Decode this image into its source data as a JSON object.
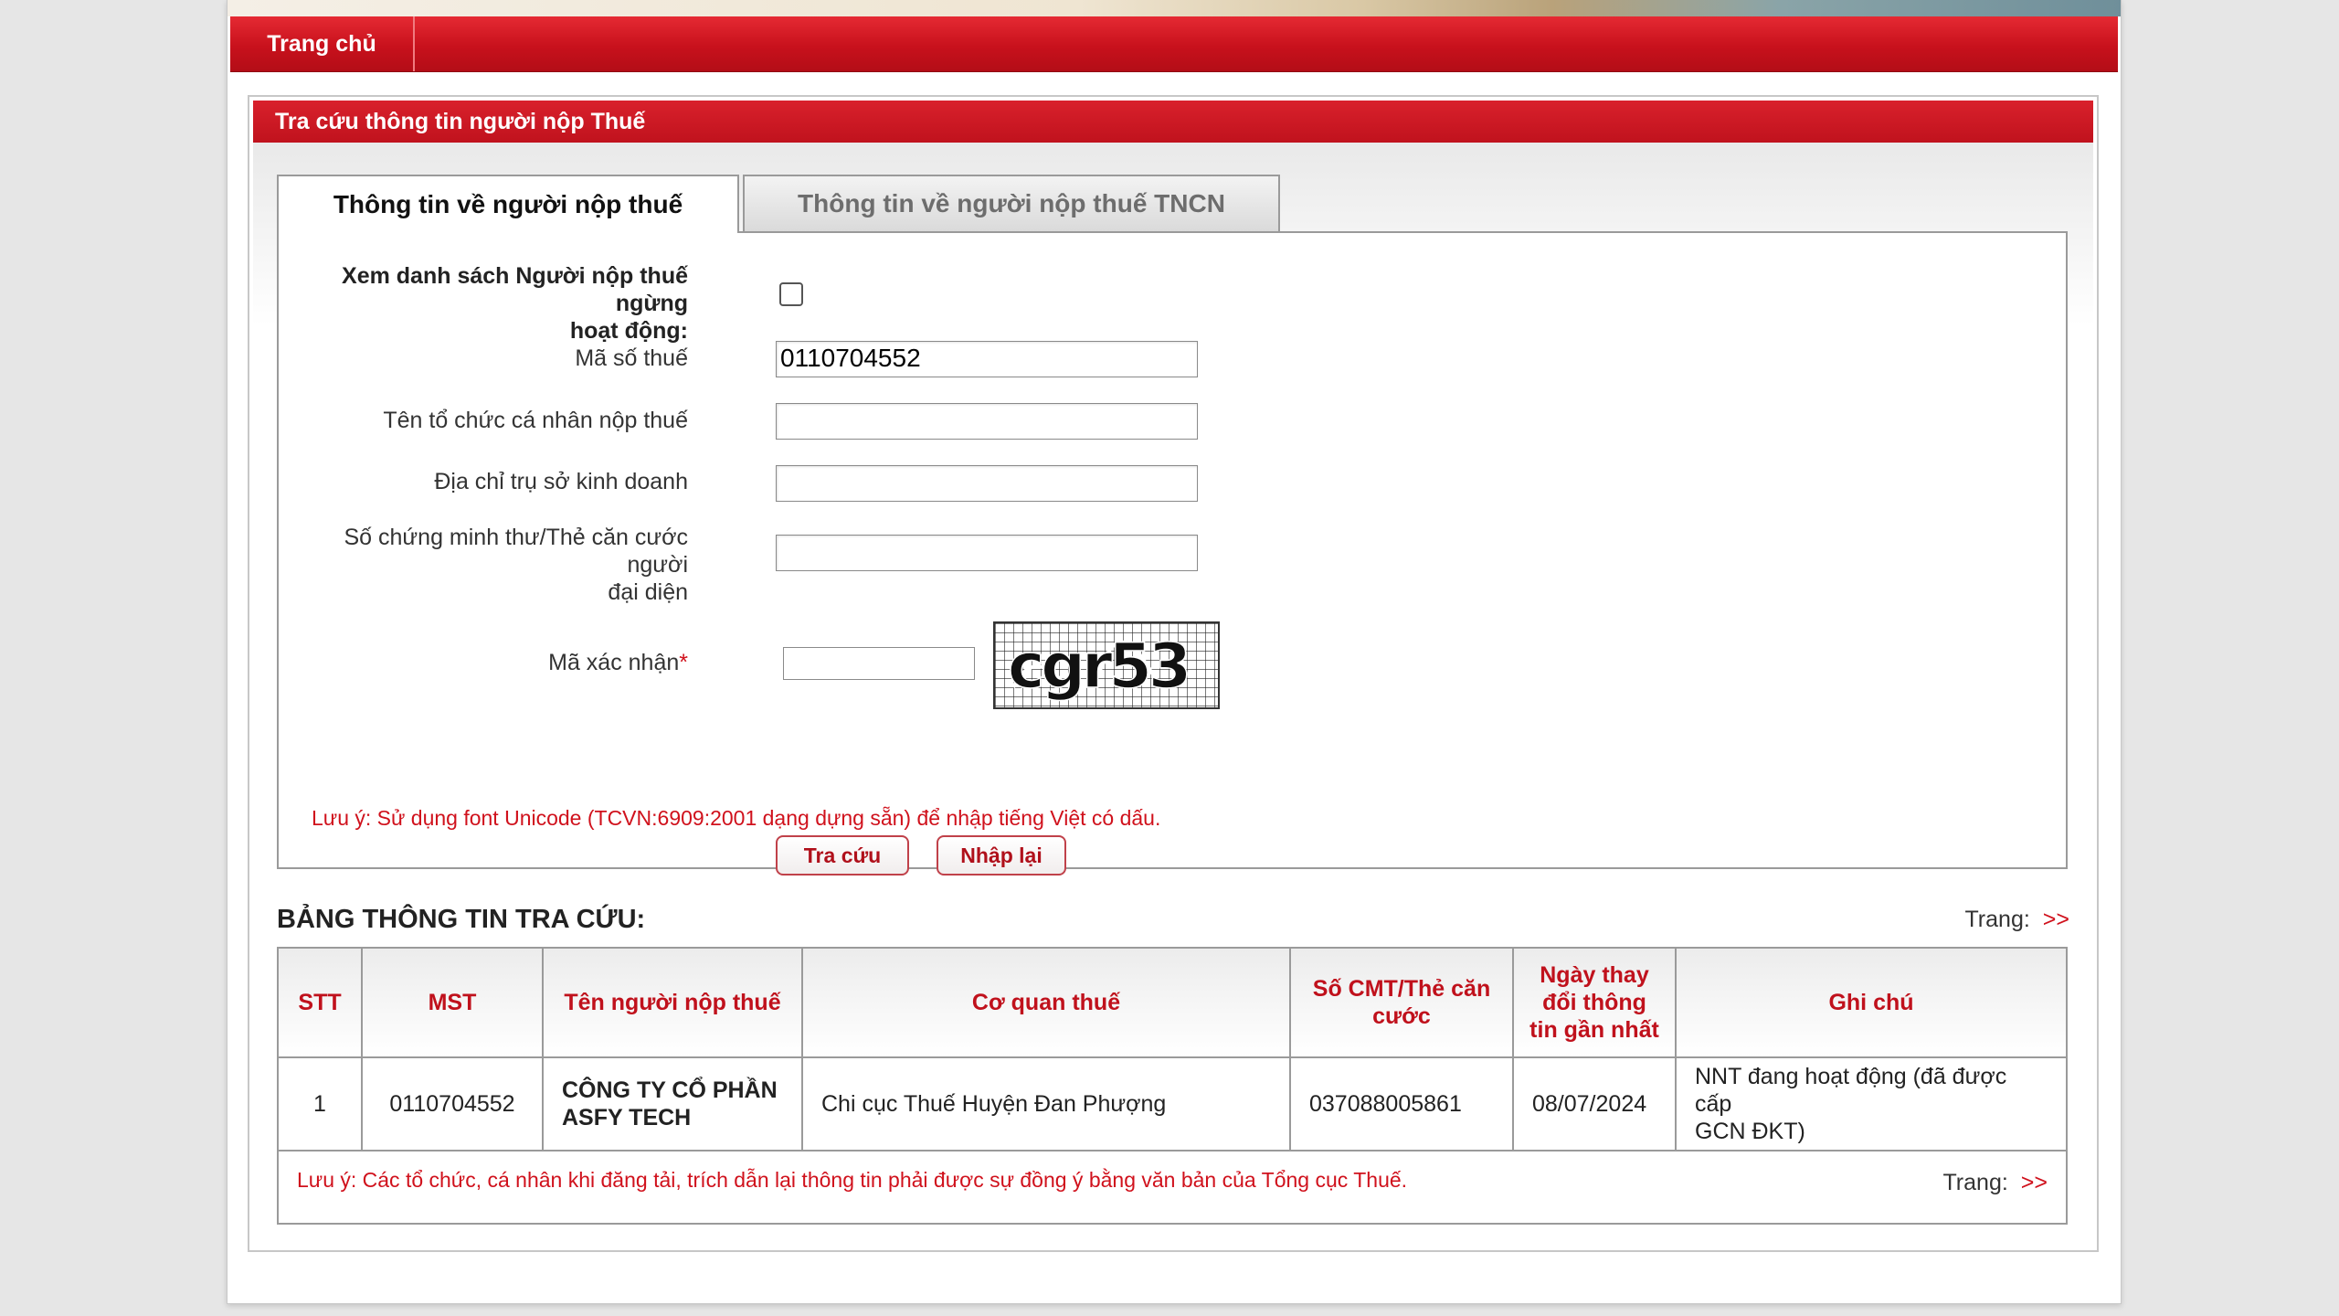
{
  "nav": {
    "home": "Trang chủ"
  },
  "panel": {
    "title": "Tra cứu thông tin người nộp Thuế"
  },
  "tabs": [
    {
      "label": "Thông tin về người nộp thuế",
      "active": true
    },
    {
      "label": "Thông tin về người nộp thuế TNCN",
      "active": false
    }
  ],
  "form": {
    "inactive_label_1": "Xem danh sách Người nộp thuế ngừng",
    "inactive_label_2": "hoạt động:",
    "tax_code_label": "Mã số thuế",
    "tax_code_value": "0110704552",
    "name_label": "Tên tổ chức cá nhân nộp thuế",
    "address_label": "Địa chỉ trụ sở kinh doanh",
    "id_label_1": "Số chứng minh thư/Thẻ căn cước người",
    "id_label_2": "đại diện",
    "captcha_label": "Mã xác nhận",
    "required_mark": "*",
    "captcha_text": "cgr53",
    "search_button": "Tra cứu",
    "reset_button": "Nhập lại",
    "note": "Lưu ý: Sử dụng font Unicode (TCVN:6909:2001 dạng dựng sẵn) để nhập tiếng Việt có dấu."
  },
  "results": {
    "title": "BẢNG THÔNG TIN TRA CỨU:",
    "pager_label": "Trang:",
    "pager_next": ">>",
    "columns": {
      "stt": "STT",
      "mst": "MST",
      "name": "Tên người nộp thuế",
      "office": "Cơ quan thuế",
      "id_1": "Số CMT/Thẻ căn",
      "id_2": "cước",
      "date_1": "Ngày thay",
      "date_2": "đổi thông",
      "date_3": "tin gần nhất",
      "note": "Ghi chú"
    },
    "rows": [
      {
        "stt": "1",
        "mst": "0110704552",
        "name_1": "CÔNG TY CỔ PHẦN",
        "name_2": "ASFY TECH",
        "office": "Chi cục Thuế Huyện Đan Phượng",
        "id": "037088005861",
        "date": "08/07/2024",
        "note_1": "NNT đang hoạt động (đã được cấp",
        "note_2": "GCN ĐKT)"
      }
    ],
    "footer_note": "Lưu ý: Các tổ chức, cá nhân khi đăng tải, trích dẫn lại thông tin phải được sự đồng ý bằng văn bản của Tổng cục Thuế."
  },
  "colors": {
    "brand_red": "#c8111c",
    "text_red": "#d0111c"
  }
}
